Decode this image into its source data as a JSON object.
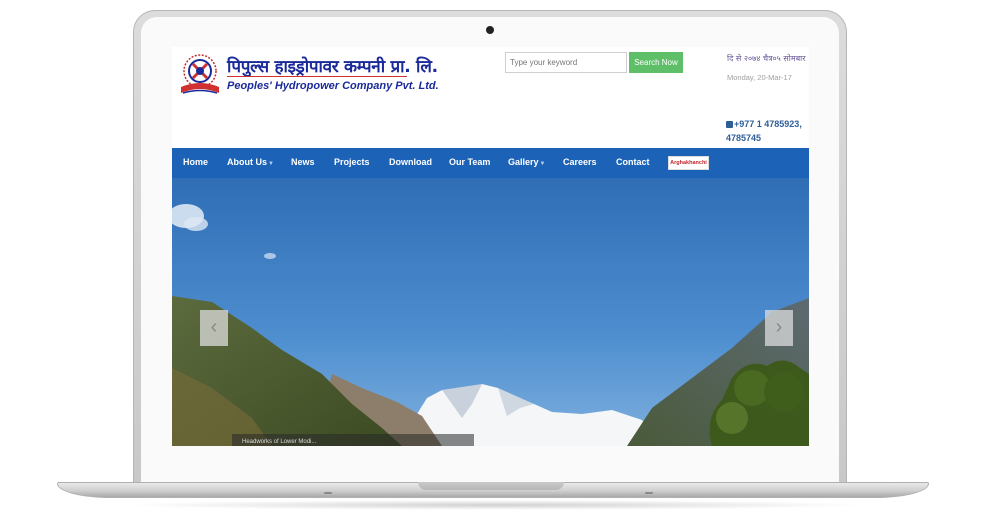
{
  "site": {
    "name_nepali": "पिपुल्स हाइड्रोपावर कम्पनी प्रा. लि.",
    "name_english": "Peoples' Hydropower Company Pvt. Ltd."
  },
  "search": {
    "placeholder": "Type your keyword",
    "button_label": "Search Now"
  },
  "header_info": {
    "date_nepali": "दि से २०७४ चैत्र०५ सोमबार",
    "date_english": "Monday, 20-Mar-17",
    "phone": "+977 1 4785923, 4785745"
  },
  "nav": {
    "items": [
      {
        "label": "Home"
      },
      {
        "label": "About Us",
        "dropdown": true
      },
      {
        "label": "News"
      },
      {
        "label": "Projects"
      },
      {
        "label": "Download"
      },
      {
        "label": "Our Team"
      },
      {
        "label": "Gallery",
        "dropdown": true
      },
      {
        "label": "Careers"
      },
      {
        "label": "Contact"
      }
    ],
    "badge_label": "Arghakhanchi"
  },
  "hero": {
    "caption": "Headworks of Lower Modi..."
  },
  "colors": {
    "nav_blue": "#1c63b8",
    "search_green": "#5fbf68",
    "brand_blue": "#1a2a9a",
    "brand_red": "#d03030"
  },
  "icons": {
    "prev": "chevron-left-icon",
    "next": "chevron-right-icon",
    "phone": "phone-icon"
  }
}
